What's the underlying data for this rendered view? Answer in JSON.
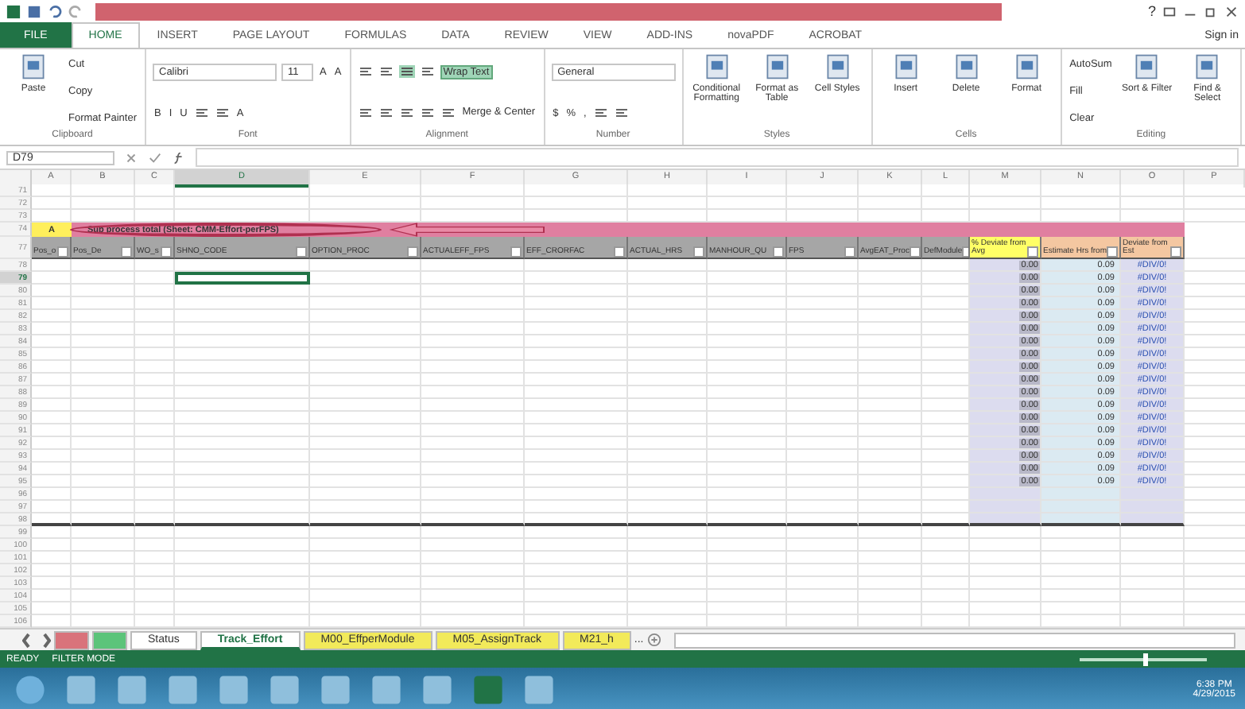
{
  "window": {
    "help": "?",
    "sign_in": "Sign in"
  },
  "ribbon_tabs": [
    {
      "label": "FILE",
      "selected": false
    },
    {
      "label": "HOME",
      "selected": true
    },
    {
      "label": "INSERT",
      "selected": false
    },
    {
      "label": "PAGE LAYOUT",
      "selected": false
    },
    {
      "label": "FORMULAS",
      "selected": false
    },
    {
      "label": "DATA",
      "selected": false
    },
    {
      "label": "REVIEW",
      "selected": false
    },
    {
      "label": "VIEW",
      "selected": false
    },
    {
      "label": "ADD-INS",
      "selected": false
    },
    {
      "label": "novaPDF",
      "selected": false
    },
    {
      "label": "ACROBAT",
      "selected": false
    }
  ],
  "ribbon_groups": [
    {
      "name": "Clipboard",
      "parts": [
        {
          "kind": "big",
          "label": "Paste"
        },
        {
          "kind": "stack",
          "lines": [
            {
              "controls": [
                {
                  "kind": "button",
                  "label": "Cut"
                }
              ]
            },
            {
              "controls": [
                {
                  "kind": "button",
                  "label": "Copy"
                }
              ]
            },
            {
              "controls": [
                {
                  "kind": "button",
                  "label": "Format Painter"
                }
              ]
            }
          ]
        }
      ]
    },
    {
      "name": "Font",
      "parts": [
        {
          "kind": "stack",
          "lines": [
            {
              "controls": [
                {
                  "kind": "field",
                  "label": "Calibri"
                },
                {
                  "kind": "field",
                  "label": "11"
                },
                {
                  "kind": "button",
                  "label": "A"
                },
                {
                  "kind": "button",
                  "label": "A"
                }
              ]
            },
            {
              "controls": [
                {
                  "kind": "button",
                  "label": "B"
                },
                {
                  "kind": "button",
                  "label": "I"
                },
                {
                  "kind": "button",
                  "label": "U"
                },
                {
                  "kind": "icon"
                },
                {
                  "kind": "icon"
                },
                {
                  "kind": "button",
                  "label": "A"
                }
              ]
            }
          ]
        }
      ]
    },
    {
      "name": "Alignment",
      "parts": [
        {
          "kind": "stack",
          "lines": [
            {
              "controls": [
                {
                  "kind": "icon"
                },
                {
                  "kind": "icon"
                },
                {
                  "kind": "toggle",
                  "on": true
                },
                {
                  "kind": "icon"
                },
                {
                  "kind": "toggle",
                  "label": "Wrap Text",
                  "on": true
                }
              ]
            },
            {
              "controls": [
                {
                  "kind": "icon"
                },
                {
                  "kind": "icon"
                },
                {
                  "kind": "icon"
                },
                {
                  "kind": "icon"
                },
                {
                  "kind": "icon"
                },
                {
                  "kind": "button",
                  "label": "Merge & Center"
                }
              ]
            }
          ]
        }
      ]
    },
    {
      "name": "Number",
      "parts": [
        {
          "kind": "stack",
          "lines": [
            {
              "controls": [
                {
                  "kind": "field",
                  "label": "General"
                }
              ]
            },
            {
              "controls": [
                {
                  "kind": "button",
                  "label": "$"
                },
                {
                  "kind": "button",
                  "label": "%"
                },
                {
                  "kind": "button",
                  "label": ","
                },
                {
                  "kind": "icon"
                },
                {
                  "kind": "icon"
                }
              ]
            }
          ]
        }
      ]
    },
    {
      "name": "Styles",
      "parts": [
        {
          "kind": "big",
          "label": "Conditional Formatting"
        },
        {
          "kind": "big",
          "label": "Format as Table"
        },
        {
          "kind": "big",
          "label": "Cell Styles"
        }
      ]
    },
    {
      "name": "Cells",
      "parts": [
        {
          "kind": "big",
          "label": "Insert"
        },
        {
          "kind": "big",
          "label": "Delete"
        },
        {
          "kind": "big",
          "label": "Format"
        }
      ]
    },
    {
      "name": "Editing",
      "parts": [
        {
          "kind": "stack",
          "lines": [
            {
              "controls": [
                {
                  "kind": "button",
                  "label": "AutoSum"
                }
              ]
            },
            {
              "controls": [
                {
                  "kind": "button",
                  "label": "Fill"
                }
              ]
            },
            {
              "controls": [
                {
                  "kind": "button",
                  "label": "Clear"
                }
              ]
            }
          ]
        },
        {
          "kind": "big",
          "label": "Sort & Filter"
        },
        {
          "kind": "big",
          "label": "Find & Select"
        }
      ]
    }
  ],
  "formula_bar": {
    "name_box": "D79"
  },
  "columns": [
    {
      "letter": "A",
      "selected": false
    },
    {
      "letter": "B",
      "selected": false
    },
    {
      "letter": "C",
      "selected": false
    },
    {
      "letter": "D",
      "selected": true
    },
    {
      "letter": "E",
      "selected": false
    },
    {
      "letter": "F",
      "selected": false
    },
    {
      "letter": "G",
      "selected": false
    },
    {
      "letter": "H",
      "selected": false
    },
    {
      "letter": "I",
      "selected": false
    },
    {
      "letter": "J",
      "selected": false
    },
    {
      "letter": "K",
      "selected": false
    },
    {
      "letter": "L",
      "selected": false
    },
    {
      "letter": "M",
      "selected": false
    },
    {
      "letter": "N",
      "selected": false
    },
    {
      "letter": "O",
      "selected": false
    },
    {
      "letter": "P",
      "selected": false
    }
  ],
  "rows": [
    {
      "number": "71",
      "kind": "blank",
      "selected": false
    },
    {
      "number": "72",
      "kind": "blank",
      "selected": false
    },
    {
      "number": "73",
      "kind": "blank",
      "selected": false
    },
    {
      "number": "74",
      "kind": "band",
      "selected": false,
      "marker": "A",
      "text": "Sub process total (Sheet: CMM-Effort-perFPS)"
    },
    {
      "number": "77",
      "kind": "header",
      "selected": false,
      "cells": [
        {
          "text": "Pos_o",
          "color": "#a6a6a6"
        },
        {
          "text": "Pos_De",
          "color": "#a6a6a6"
        },
        {
          "text": "WO_s",
          "color": "#a6a6a6"
        },
        {
          "text": "SHNO_CODE",
          "color": "#a6a6a6"
        },
        {
          "text": "OPTION_PROC",
          "color": "#a6a6a6"
        },
        {
          "text": "ACTUALEFF_FPS",
          "color": "#a6a6a6"
        },
        {
          "text": "EFF_CRORFAC",
          "color": "#a6a6a6"
        },
        {
          "text": "ACTUAL_HRS",
          "color": "#a6a6a6"
        },
        {
          "text": "MANHOUR_QU",
          "color": "#a6a6a6"
        },
        {
          "text": "FPS",
          "color": "#a6a6a6"
        },
        {
          "text": "AvgEAT_Proc",
          "color": "#a6a6a6"
        },
        {
          "text": "DefModule",
          "color": "#a6a6a6"
        },
        {
          "text": "% Deviate from Avg",
          "color": "#ffff66"
        },
        {
          "text": "Estimate Hrs from",
          "color": "#f4c7a1"
        },
        {
          "text": "Deviate from Est",
          "color": "#f4c7a1"
        }
      ]
    },
    {
      "number": "78",
      "kind": "data",
      "selected": false,
      "m": "0.00",
      "n": "0.09",
      "o": "#DIV/0!"
    },
    {
      "number": "79",
      "kind": "data",
      "selected": true,
      "m": "0.00",
      "n": "0.09",
      "o": "#DIV/0!"
    },
    {
      "number": "80",
      "kind": "data",
      "selected": false,
      "m": "0.00",
      "n": "0.09",
      "o": "#DIV/0!"
    },
    {
      "number": "81",
      "kind": "data",
      "selected": false,
      "m": "0.00",
      "n": "0.09",
      "o": "#DIV/0!"
    },
    {
      "number": "82",
      "kind": "data",
      "selected": false,
      "m": "0.00",
      "n": "0.09",
      "o": "#DIV/0!"
    },
    {
      "number": "83",
      "kind": "data",
      "selected": false,
      "m": "0.00",
      "n": "0.09",
      "o": "#DIV/0!"
    },
    {
      "number": "84",
      "kind": "data",
      "selected": false,
      "m": "0.00",
      "n": "0.09",
      "o": "#DIV/0!"
    },
    {
      "number": "85",
      "kind": "data",
      "selected": false,
      "m": "0.00",
      "n": "0.09",
      "o": "#DIV/0!"
    },
    {
      "number": "86",
      "kind": "data",
      "selected": false,
      "m": "0.00",
      "n": "0.09",
      "o": "#DIV/0!"
    },
    {
      "number": "87",
      "kind": "data",
      "selected": false,
      "m": "0.00",
      "n": "0.09",
      "o": "#DIV/0!"
    },
    {
      "number": "88",
      "kind": "data",
      "selected": false,
      "m": "0.00",
      "n": "0.09",
      "o": "#DIV/0!"
    },
    {
      "number": "89",
      "kind": "data",
      "selected": false,
      "m": "0.00",
      "n": "0.09",
      "o": "#DIV/0!"
    },
    {
      "number": "90",
      "kind": "data",
      "selected": false,
      "m": "0.00",
      "n": "0.09",
      "o": "#DIV/0!"
    },
    {
      "number": "91",
      "kind": "data",
      "selected": false,
      "m": "0.00",
      "n": "0.09",
      "o": "#DIV/0!"
    },
    {
      "number": "92",
      "kind": "data",
      "selected": false,
      "m": "0.00",
      "n": "0.09",
      "o": "#DIV/0!"
    },
    {
      "number": "93",
      "kind": "data",
      "selected": false,
      "m": "0.00",
      "n": "0.09",
      "o": "#DIV/0!"
    },
    {
      "number": "94",
      "kind": "data",
      "selected": false,
      "m": "0.00",
      "n": "0.09",
      "o": "#DIV/0!"
    },
    {
      "number": "95",
      "kind": "data",
      "selected": false,
      "m": "0.00",
      "n": "0.09",
      "o": "#DIV/0!"
    },
    {
      "number": "96",
      "kind": "data",
      "selected": false
    },
    {
      "number": "97",
      "kind": "data",
      "selected": false
    },
    {
      "number": "98",
      "kind": "data",
      "selected": false
    },
    {
      "number": "99",
      "kind": "blank",
      "selected": false
    },
    {
      "number": "100",
      "kind": "blank",
      "selected": false
    },
    {
      "number": "101",
      "kind": "blank",
      "selected": false
    },
    {
      "number": "102",
      "kind": "blank",
      "selected": false
    },
    {
      "number": "103",
      "kind": "blank",
      "selected": false
    },
    {
      "number": "104",
      "kind": "blank",
      "selected": false
    },
    {
      "number": "105",
      "kind": "blank",
      "selected": false
    },
    {
      "number": "106",
      "kind": "blank",
      "selected": false
    }
  ],
  "sheet_tabs": [
    {
      "color": "#d9737b",
      "selected": false
    },
    {
      "color": "#5cc47a",
      "selected": false
    },
    {
      "label": "Status",
      "color": "#ffffff",
      "selected": false
    },
    {
      "label": "Track_Effort",
      "color": "#ffffff",
      "selected": true
    },
    {
      "label": "M00_EffperModule",
      "color": "#f2ea5a",
      "selected": false
    },
    {
      "label": "M05_AssignTrack",
      "color": "#f2ea5a",
      "selected": false
    },
    {
      "label": "M21_h",
      "color": "#f2ea5a",
      "selected": false
    }
  ],
  "sheet_more": "...",
  "status_bar": {
    "mode": "READY",
    "filter": "FILTER MODE",
    "zoom": {
      "level": 0.5
    }
  },
  "taskbar": {
    "time": "6:38 PM",
    "date": "4/29/2015"
  }
}
